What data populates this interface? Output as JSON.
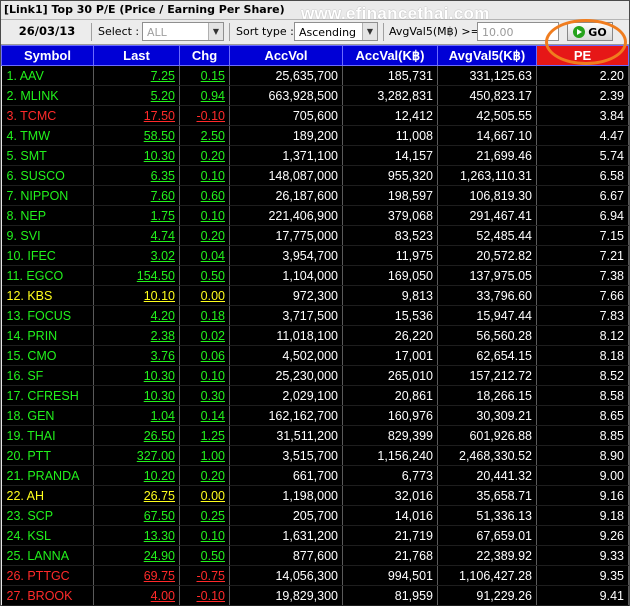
{
  "window": {
    "title": "[Link1] Top 30 P/E (Price / Earning Per Share)",
    "watermark": "www.efinancethai.com"
  },
  "toolbar": {
    "date": "26/03/13",
    "select_label": "Select :",
    "select_value": "ALL",
    "sort_label": "Sort type :",
    "sort_value": "Ascending",
    "avg_label": "AvgVal5(M฿) >=",
    "avg_value": "10.00",
    "go_label": "GO"
  },
  "table": {
    "headers": [
      "Symbol",
      "Last",
      "Chg",
      "AccVol",
      "AccVal(K฿)",
      "AvgVal5(K฿)",
      "PE"
    ],
    "rows": [
      {
        "symbol": "1. AAV",
        "last": "7.25",
        "chg": "0.15",
        "accvol": "25,635,700",
        "accval": "185,731",
        "avgval5": "331,125.63",
        "pe": "2.20",
        "color": "green"
      },
      {
        "symbol": "2. MLINK",
        "last": "5.20",
        "chg": "0.94",
        "accvol": "663,928,500",
        "accval": "3,282,831",
        "avgval5": "450,823.17",
        "pe": "2.39",
        "color": "green"
      },
      {
        "symbol": "3. TCMC",
        "last": "17.50",
        "chg": "-0.10",
        "accvol": "705,600",
        "accval": "12,412",
        "avgval5": "42,505.55",
        "pe": "3.84",
        "color": "red"
      },
      {
        "symbol": "4. TMW",
        "last": "58.50",
        "chg": "2.50",
        "accvol": "189,200",
        "accval": "11,008",
        "avgval5": "14,667.10",
        "pe": "4.47",
        "color": "green"
      },
      {
        "symbol": "5. SMT",
        "last": "10.30",
        "chg": "0.20",
        "accvol": "1,371,100",
        "accval": "14,157",
        "avgval5": "21,699.46",
        "pe": "5.74",
        "color": "green"
      },
      {
        "symbol": "6. SUSCO",
        "last": "6.35",
        "chg": "0.10",
        "accvol": "148,087,000",
        "accval": "955,320",
        "avgval5": "1,263,110.31",
        "pe": "6.58",
        "color": "green"
      },
      {
        "symbol": "7. NIPPON",
        "last": "7.60",
        "chg": "0.60",
        "accvol": "26,187,600",
        "accval": "198,597",
        "avgval5": "106,819.30",
        "pe": "6.67",
        "color": "green"
      },
      {
        "symbol": "8. NEP",
        "last": "1.75",
        "chg": "0.10",
        "accvol": "221,406,900",
        "accval": "379,068",
        "avgval5": "291,467.41",
        "pe": "6.94",
        "color": "green"
      },
      {
        "symbol": "9. SVI",
        "last": "4.74",
        "chg": "0.20",
        "accvol": "17,775,000",
        "accval": "83,523",
        "avgval5": "52,485.44",
        "pe": "7.15",
        "color": "green"
      },
      {
        "symbol": "10. IFEC",
        "last": "3.02",
        "chg": "0.04",
        "accvol": "3,954,700",
        "accval": "11,975",
        "avgval5": "20,572.82",
        "pe": "7.21",
        "color": "green"
      },
      {
        "symbol": "11. EGCO",
        "last": "154.50",
        "chg": "0.50",
        "accvol": "1,104,000",
        "accval": "169,050",
        "avgval5": "137,975.05",
        "pe": "7.38",
        "color": "green"
      },
      {
        "symbol": "12. KBS",
        "last": "10.10",
        "chg": "0.00",
        "accvol": "972,300",
        "accval": "9,813",
        "avgval5": "33,796.60",
        "pe": "7.66",
        "color": "yellow"
      },
      {
        "symbol": "13. FOCUS",
        "last": "4.20",
        "chg": "0.18",
        "accvol": "3,717,500",
        "accval": "15,536",
        "avgval5": "15,947.44",
        "pe": "7.83",
        "color": "green"
      },
      {
        "symbol": "14. PRIN",
        "last": "2.38",
        "chg": "0.02",
        "accvol": "11,018,100",
        "accval": "26,220",
        "avgval5": "56,560.28",
        "pe": "8.12",
        "color": "green"
      },
      {
        "symbol": "15. CMO",
        "last": "3.76",
        "chg": "0.06",
        "accvol": "4,502,000",
        "accval": "17,001",
        "avgval5": "62,654.15",
        "pe": "8.18",
        "color": "green"
      },
      {
        "symbol": "16. SF",
        "last": "10.30",
        "chg": "0.10",
        "accvol": "25,230,000",
        "accval": "265,010",
        "avgval5": "157,212.72",
        "pe": "8.52",
        "color": "green"
      },
      {
        "symbol": "17. CFRESH",
        "last": "10.30",
        "chg": "0.30",
        "accvol": "2,029,100",
        "accval": "20,861",
        "avgval5": "18,266.15",
        "pe": "8.58",
        "color": "green"
      },
      {
        "symbol": "18. GEN",
        "last": "1.04",
        "chg": "0.14",
        "accvol": "162,162,700",
        "accval": "160,976",
        "avgval5": "30,309.21",
        "pe": "8.65",
        "color": "green"
      },
      {
        "symbol": "19. THAI",
        "last": "26.50",
        "chg": "1.25",
        "accvol": "31,511,200",
        "accval": "829,399",
        "avgval5": "601,926.88",
        "pe": "8.85",
        "color": "green"
      },
      {
        "symbol": "20. PTT",
        "last": "327.00",
        "chg": "1.00",
        "accvol": "3,515,700",
        "accval": "1,156,240",
        "avgval5": "2,468,330.52",
        "pe": "8.90",
        "color": "green"
      },
      {
        "symbol": "21. PRANDA",
        "last": "10.20",
        "chg": "0.20",
        "accvol": "661,700",
        "accval": "6,773",
        "avgval5": "20,441.32",
        "pe": "9.00",
        "color": "green"
      },
      {
        "symbol": "22. AH",
        "last": "26.75",
        "chg": "0.00",
        "accvol": "1,198,000",
        "accval": "32,016",
        "avgval5": "35,658.71",
        "pe": "9.16",
        "color": "yellow"
      },
      {
        "symbol": "23. SCP",
        "last": "67.50",
        "chg": "0.25",
        "accvol": "205,700",
        "accval": "14,016",
        "avgval5": "51,336.13",
        "pe": "9.18",
        "color": "green"
      },
      {
        "symbol": "24. KSL",
        "last": "13.30",
        "chg": "0.10",
        "accvol": "1,631,200",
        "accval": "21,719",
        "avgval5": "67,659.01",
        "pe": "9.26",
        "color": "green"
      },
      {
        "symbol": "25. LANNA",
        "last": "24.90",
        "chg": "0.50",
        "accvol": "877,600",
        "accval": "21,768",
        "avgval5": "22,389.92",
        "pe": "9.33",
        "color": "green"
      },
      {
        "symbol": "26. PTTGC",
        "last": "69.75",
        "chg": "-0.75",
        "accvol": "14,056,300",
        "accval": "994,501",
        "avgval5": "1,106,427.28",
        "pe": "9.35",
        "color": "red"
      },
      {
        "symbol": "27. BROOK",
        "last": "4.00",
        "chg": "-0.10",
        "accvol": "19,829,300",
        "accval": "81,959",
        "avgval5": "91,229.26",
        "pe": "9.41",
        "color": "red"
      }
    ]
  },
  "colors": {
    "header_bg": "#0000d6",
    "pe_header_bg": "#e61717",
    "up": "#22f21c",
    "down": "#ff2a2a",
    "unchanged": "#ffff1c",
    "highlight": "#f07d1f"
  }
}
